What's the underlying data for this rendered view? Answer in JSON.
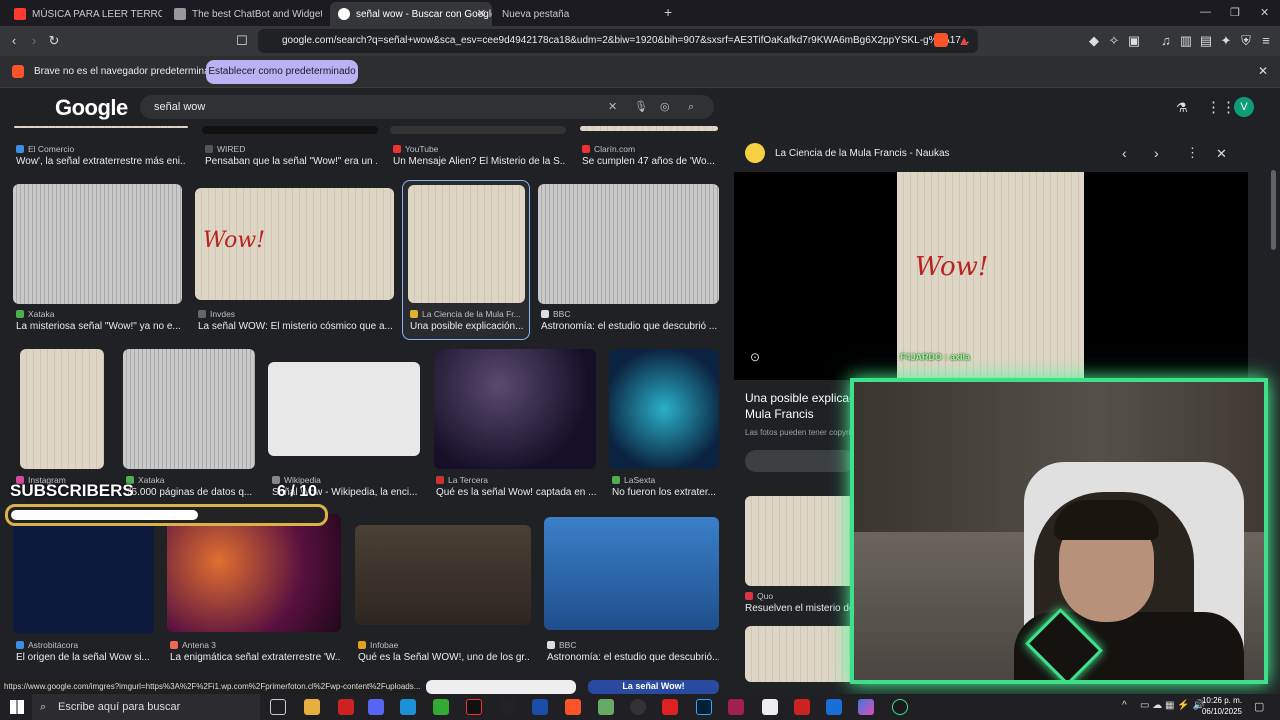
{
  "tabs": [
    {
      "label": "MÚSICA PARA LEER TERROR Y M",
      "icon": "youtube-icon"
    },
    {
      "label": "The best ChatBot and Widgets for Ki",
      "icon": "widget-icon"
    },
    {
      "label": "señal wow - Buscar con Google",
      "icon": "google-icon"
    },
    {
      "label": "Nueva pestaña",
      "icon": "blank-icon"
    }
  ],
  "url": "google.com/search?q=señal+wow&sca_esv=cee9d4942178ca18&udm=2&biw=1920&bih=907&sxsrf=AE3TifOaKafkd7r9KWA6mBg6X2ppYSKL-g%3A17...",
  "infobar": {
    "text": "Brave no es el navegador predeterminado",
    "button": "Establecer como predeterminado"
  },
  "google": {
    "logo": "Google",
    "query": "señal wow",
    "avatar": "V"
  },
  "row0": [
    {
      "source": "El Comercio",
      "title": "Wow', la señal extraterrestre más eni..."
    },
    {
      "source": "WIRED",
      "title": "Pensaban que la señal \"Wow!\" era un ..."
    },
    {
      "source": "YouTube",
      "title": "Un Mensaje Alien? El Misterio de la S..."
    },
    {
      "source": "Clarín.com",
      "title": "Se cumplen 47 años de 'Wo..."
    }
  ],
  "row1": [
    {
      "source": "Xataka",
      "title": "La misteriosa señal \"Wow!\" ya no e..."
    },
    {
      "source": "Invdes",
      "title": "La señal WOW: El misterio cósmico que a..."
    },
    {
      "source": "La Ciencia de la Mula Fr...",
      "title": "Una posible explicación..."
    },
    {
      "source": "BBC",
      "title": "Astronomía: el estudio que descubrió ..."
    }
  ],
  "row2": [
    {
      "source": "Instagram",
      "title": ""
    },
    {
      "source": "Xataka",
      "title": "75.000 páginas de datos q..."
    },
    {
      "source": "Wikipedia",
      "title": "Señal Wow - Wikipedia, la enci..."
    },
    {
      "source": "La Tercera",
      "title": "Qué es la señal Wow! captada en ..."
    },
    {
      "source": "LaSexta",
      "title": "No fueron los extrater..."
    }
  ],
  "row3": [
    {
      "source": "Astrobitácora",
      "title": "El origen de la señal Wow si..."
    },
    {
      "source": "Antena 3",
      "title": "La enigmática señal extraterrestre 'W..."
    },
    {
      "source": "Infobae",
      "title": "Qué es la Señal WOW!, uno de los gr..."
    },
    {
      "source": "BBC",
      "title": "Astronomía: el estudio que descubrió..."
    }
  ],
  "partial_card": "La señal Wow!",
  "panel": {
    "site": "La Ciencia de la Mula Francis - Naukas",
    "title_line1": "Una posible explicac",
    "title_line2": "Mula Francis",
    "note": "Las fotos pueden tener copyri",
    "related": [
      {
        "source": "Quo",
        "title": "Resuelven el misterio de"
      }
    ]
  },
  "overlay": {
    "subscribers_label": "SUBSCRIBERS",
    "subscribers_count": "6 / 10",
    "subscribers_progress": 0.6,
    "cam_label": "F4JARDO : axila"
  },
  "status_url": "https://www.google.com/imgres?imgurl=https%3A%2F%2Fi1.wp.com%2Fprimerfoton.cl%2Fwp-content%2Fuploads...",
  "taskbar": {
    "search": "Escribe aquí para buscar",
    "time": "10:26 p. m.",
    "date": "06/10/2025"
  },
  "colors": {
    "accent": "#3ee08a",
    "infobar_button": "#b9b2f5",
    "bar_border": "#d9b24a"
  }
}
